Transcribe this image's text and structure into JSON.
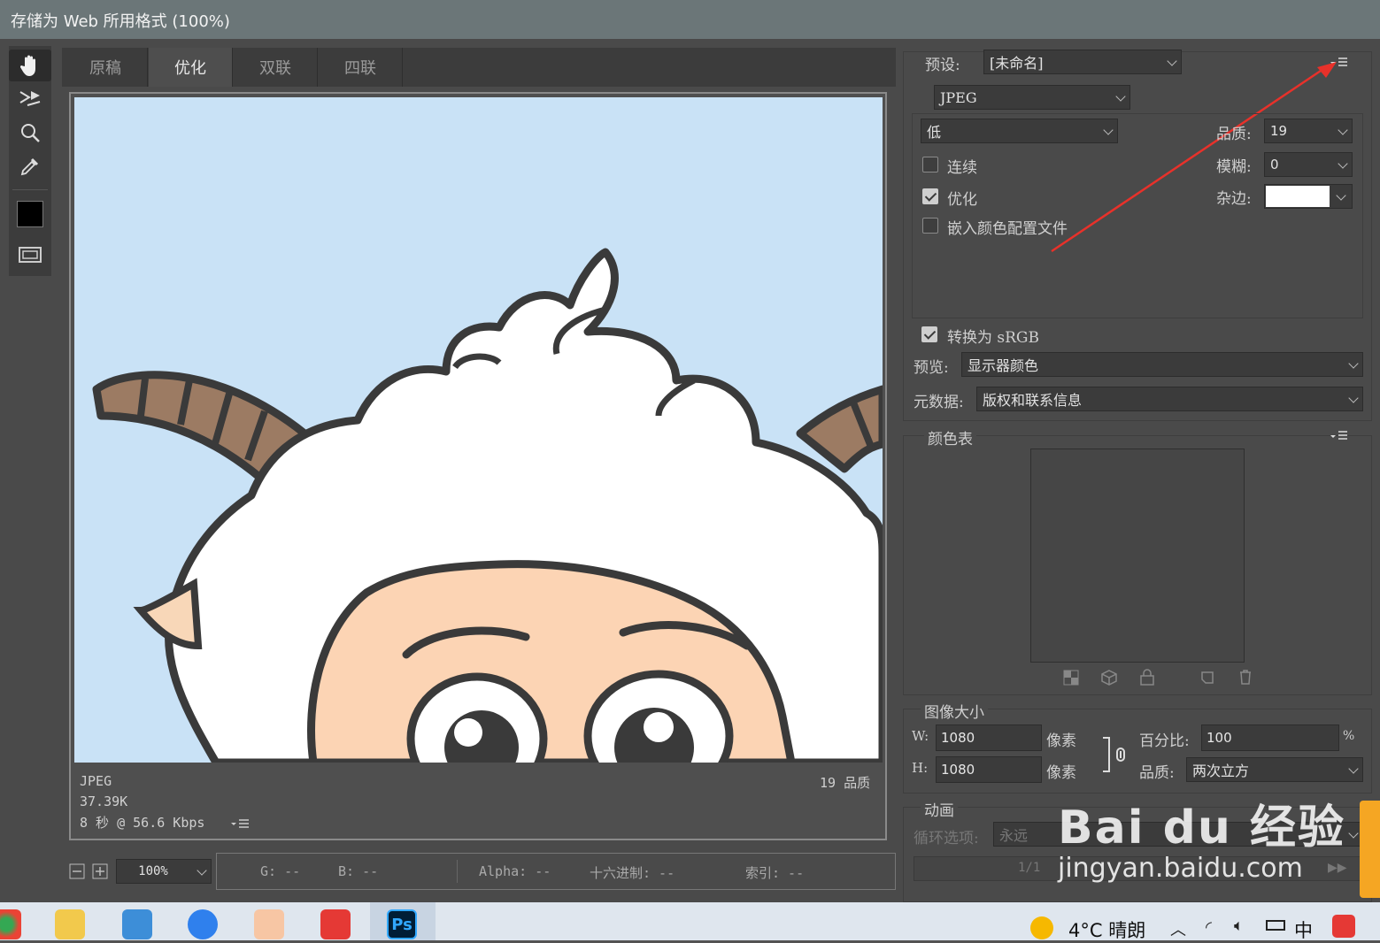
{
  "window": {
    "title": "存储为 Web 所用格式 (100%)"
  },
  "tabs": [
    "原稿",
    "优化",
    "双联",
    "四联"
  ],
  "active_tab": "优化",
  "preview_info": {
    "format": "JPEG",
    "size": "37.39K",
    "speed": "8 秒 @ 56.6 Kbps",
    "quality": "19 品质"
  },
  "zoom": "100%",
  "status": {
    "g": "G: --",
    "b": "B: --",
    "alpha": "Alpha: --",
    "hex": "十六进制: --",
    "index": "索引: --"
  },
  "settings": {
    "preset_label": "预设:",
    "preset_value": "[未命名]",
    "format_value": "JPEG",
    "quality_level": "低",
    "quality_label": "品质:",
    "quality_value": "19",
    "blur_label": "模糊:",
    "blur_value": "0",
    "matte_label": "杂边:",
    "progressive": "连续",
    "optimized": "优化",
    "embed_profile": "嵌入颜色配置文件",
    "convert_srgb": "转换为 sRGB",
    "preview_label": "预览:",
    "preview_value": "显示器颜色",
    "metadata_label": "元数据:",
    "metadata_value": "版权和联系信息"
  },
  "color_table": {
    "title": "颜色表"
  },
  "image_size": {
    "title": "图像大小",
    "w_label": "W:",
    "w_value": "1080",
    "h_label": "H:",
    "h_value": "1080",
    "unit": "像素",
    "percent_label": "百分比:",
    "percent_value": "100",
    "percent_unit": "%",
    "quality_label": "品质:",
    "quality_value": "两次立方"
  },
  "animation": {
    "title": "动画",
    "loop_label": "循环选项:",
    "loop_value": "永远",
    "frame": "1/1"
  },
  "taskbar": {
    "weather": "4°C 晴朗",
    "ime": "中"
  },
  "watermark": {
    "brand": "Bai du 经验",
    "url": "jingyan.baidu.com"
  }
}
